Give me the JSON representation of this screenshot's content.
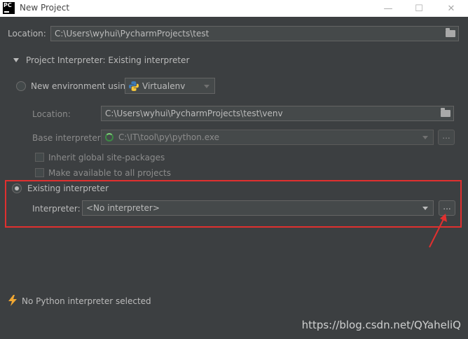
{
  "window": {
    "logo_text": "PC",
    "title": "New Project",
    "minimize_glyph": "—",
    "maximize_glyph": "☐",
    "close_glyph": "✕"
  },
  "location": {
    "label": "Location:",
    "value": "C:\\Users\\wyhui\\PycharmProjects\\test"
  },
  "interpreter_section": {
    "header": "Project Interpreter: Existing interpreter"
  },
  "new_env": {
    "radio_label": "New environment using",
    "tool": "Virtualenv",
    "location_label": "Location:",
    "location_value": "C:\\Users\\wyhui\\PycharmProjects\\test\\venv",
    "base_label": "Base interpreter:",
    "base_value": "C:\\IT\\tool\\py\\python.exe",
    "browse_label": "...",
    "inherit_label": "Inherit global site-packages",
    "make_available_label": "Make available to all projects"
  },
  "existing": {
    "radio_label": "Existing interpreter",
    "interpreter_label": "Interpreter:",
    "interpreter_value": "<No interpreter>",
    "browse_label": "..."
  },
  "status": {
    "message": "No Python interpreter selected"
  },
  "watermark": "https://blog.csdn.net/QYaheliQ",
  "colors": {
    "background": "#3c3f41",
    "highlight": "#e0302f",
    "warning": "#f0a732"
  }
}
